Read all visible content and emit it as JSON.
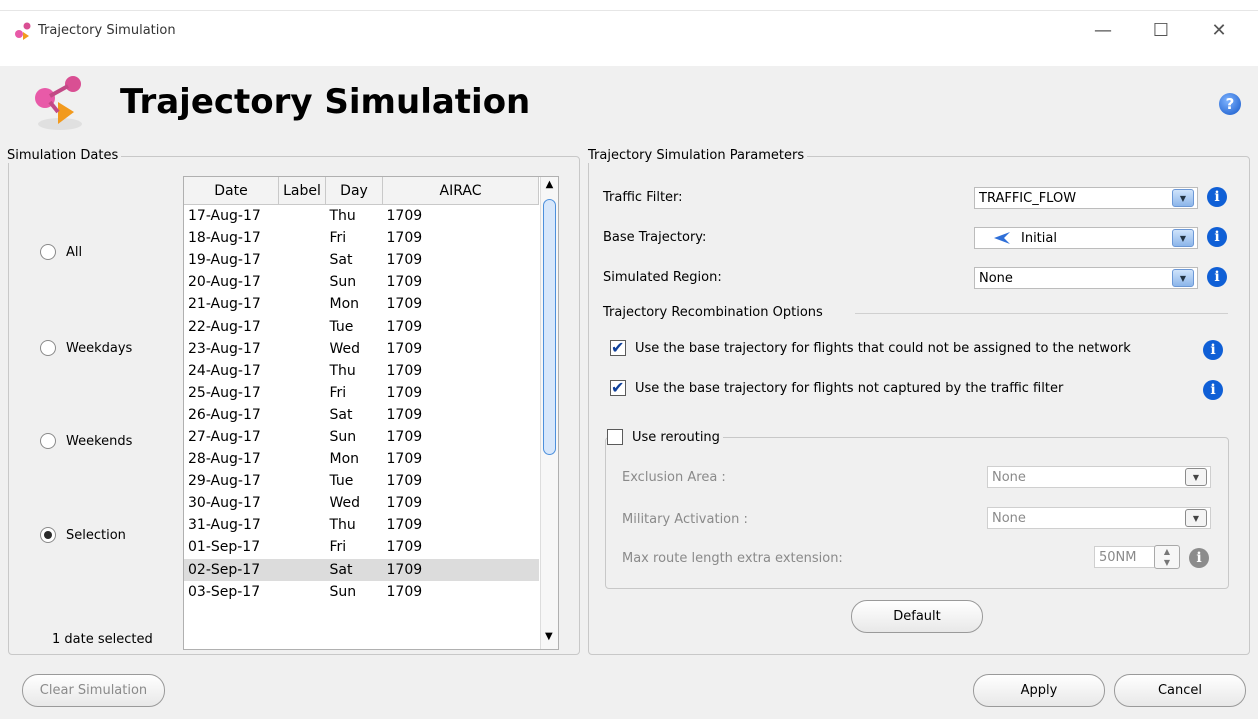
{
  "window": {
    "title": "Trajectory Simulation",
    "minimize": "—",
    "maximize": "☐",
    "close": "✕"
  },
  "header": {
    "title": "Trajectory Simulation",
    "help": "?"
  },
  "dates": {
    "group_label": "Simulation Dates",
    "options": [
      {
        "label": "All",
        "selected": false
      },
      {
        "label": "Weekdays",
        "selected": false
      },
      {
        "label": "Weekends",
        "selected": false
      },
      {
        "label": "Selection",
        "selected": true
      }
    ],
    "status": "1 date selected",
    "columns": [
      "Date",
      "Label",
      "Day",
      "AIRAC"
    ],
    "rows": [
      [
        "17-Aug-17",
        "",
        "Thu",
        "1709"
      ],
      [
        "18-Aug-17",
        "",
        "Fri",
        "1709"
      ],
      [
        "19-Aug-17",
        "",
        "Sat",
        "1709"
      ],
      [
        "20-Aug-17",
        "",
        "Sun",
        "1709"
      ],
      [
        "21-Aug-17",
        "",
        "Mon",
        "1709"
      ],
      [
        "22-Aug-17",
        "",
        "Tue",
        "1709"
      ],
      [
        "23-Aug-17",
        "",
        "Wed",
        "1709"
      ],
      [
        "24-Aug-17",
        "",
        "Thu",
        "1709"
      ],
      [
        "25-Aug-17",
        "",
        "Fri",
        "1709"
      ],
      [
        "26-Aug-17",
        "",
        "Sat",
        "1709"
      ],
      [
        "27-Aug-17",
        "",
        "Sun",
        "1709"
      ],
      [
        "28-Aug-17",
        "",
        "Mon",
        "1709"
      ],
      [
        "29-Aug-17",
        "",
        "Tue",
        "1709"
      ],
      [
        "30-Aug-17",
        "",
        "Wed",
        "1709"
      ],
      [
        "31-Aug-17",
        "",
        "Thu",
        "1709"
      ],
      [
        "01-Sep-17",
        "",
        "Fri",
        "1709"
      ],
      [
        "02-Sep-17",
        "",
        "Sat",
        "1709"
      ],
      [
        "03-Sep-17",
        "",
        "Sun",
        "1709"
      ]
    ],
    "selected_row": "02-Sep-17"
  },
  "params": {
    "group_label": "Trajectory Simulation Parameters",
    "traffic_filter_label": "Traffic Filter:",
    "traffic_filter_value": "TRAFFIC_FLOW",
    "base_trajectory_label": "Base Trajectory:",
    "base_trajectory_value": "Initial",
    "simulated_region_label": "Simulated Region:",
    "simulated_region_value": "None",
    "recombination_label": "Trajectory Recombination Options",
    "opt_network": "Use the base trajectory for flights that could not be assigned to the network",
    "opt_network_checked": true,
    "opt_filter": "Use the base trajectory for flights not captured by the traffic filter",
    "opt_filter_checked": true,
    "rerouting_label": "Use rerouting",
    "rerouting_checked": false,
    "exclusion_label": "Exclusion Area :",
    "exclusion_value": "None",
    "military_label": "Military Activation :",
    "military_value": "None",
    "max_route_label": "Max route length extra extension:",
    "max_route_value": "50NM",
    "default_button": "Default",
    "info_glyph": "i"
  },
  "footer": {
    "clear": "Clear Simulation",
    "apply": "Apply",
    "cancel": "Cancel"
  }
}
